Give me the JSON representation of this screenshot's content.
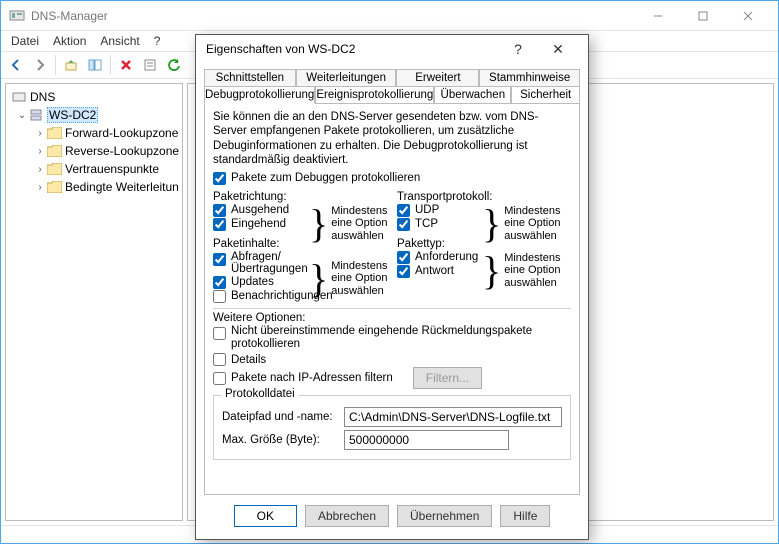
{
  "app": {
    "title": "DNS-Manager"
  },
  "menu": {
    "file": "Datei",
    "action": "Aktion",
    "view": "Ansicht",
    "help": "?"
  },
  "tree": {
    "root": "DNS",
    "server": "WS-DC2",
    "n1": "Forward-Lookupzone",
    "n2": "Reverse-Lookupzone",
    "n3": "Vertrauenspunkte",
    "n4": "Bedingte Weiterleitun"
  },
  "dialog": {
    "title": "Eigenschaften von WS-DC2",
    "help_glyph": "?",
    "close_glyph": "✕",
    "tabs_back": {
      "t1": "Schnittstellen",
      "t2": "Weiterleitungen",
      "t3": "Erweitert",
      "t4": "Stammhinweise"
    },
    "tabs_front": {
      "t1": "Debugprotokollierung",
      "t2": "Ereignisprotokollierung",
      "t3": "Überwachen",
      "t4": "Sicherheit"
    },
    "desc": "Sie können die an den DNS-Server gesendeten bzw. vom DNS-Server empfangenen Pakete protokollieren, um zusätzliche Debuginformationen zu erhalten. Die Debugprotokollierung ist standardmäßig deaktiviert.",
    "chk_main": "Pakete zum Debuggen protokollieren",
    "direction_title": "Paketrichtung:",
    "direction_out": "Ausgehend",
    "direction_in": "Eingehend",
    "transport_title": "Transportprotokoll:",
    "udp": "UDP",
    "tcp": "TCP",
    "content_title": "Paketinhalte:",
    "content_q": "Abfragen/\nÜbertragungen",
    "content_upd": "Updates",
    "content_not": "Benachrichtigungen",
    "type_title": "Pakettyp:",
    "type_req": "Anforderung",
    "type_ans": "Antwort",
    "hint": "Mindestens eine Option auswählen",
    "other_title": "Weitere Optionen:",
    "other_mismatch": "Nicht übereinstimmende eingehende Rückmeldungspakete protokollieren",
    "other_details": "Details",
    "other_ipfilter": "Pakete nach IP-Adressen filtern",
    "filter_btn": "Filtern...",
    "logfile_legend": "Protokolldatei",
    "path_label": "Dateipfad und -name:",
    "path_value": "C:\\Admin\\DNS-Server\\DNS-Logfile.txt",
    "size_label": "Max. Größe (Byte):",
    "size_value": "500000000",
    "ok": "OK",
    "cancel": "Abbrechen",
    "apply": "Übernehmen",
    "help": "Hilfe"
  }
}
